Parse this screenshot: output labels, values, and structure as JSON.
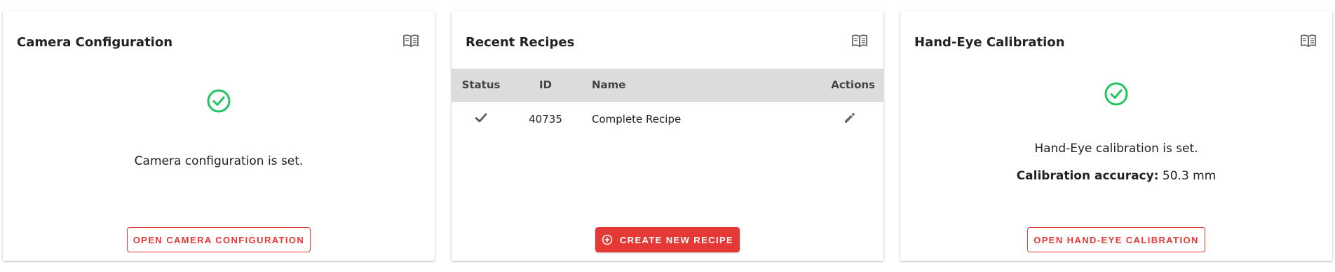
{
  "camera": {
    "title": "Camera Configuration",
    "status_text": "Camera configuration is set.",
    "button_label": "OPEN CAMERA CONFIGURATION"
  },
  "recipes": {
    "title": "Recent Recipes",
    "columns": {
      "status": "Status",
      "id": "ID",
      "name": "Name",
      "actions": "Actions"
    },
    "rows": [
      {
        "status_icon": "check-icon",
        "id": "40735",
        "name": "Complete Recipe",
        "action_icon": "edit-pencil-icon"
      }
    ],
    "button_label": "CREATE NEW RECIPE",
    "button_icon": "add-circle-icon"
  },
  "handeye": {
    "title": "Hand-Eye Calibration",
    "status_text": "Hand-Eye calibration is set.",
    "accuracy_label": "Calibration accuracy:",
    "accuracy_value": "50.3 mm",
    "button_label": "OPEN HAND-EYE CALIBRATION"
  },
  "colors": {
    "accent": "#e53935",
    "success": "#22c55e",
    "header_bg": "#dcdcdc"
  }
}
